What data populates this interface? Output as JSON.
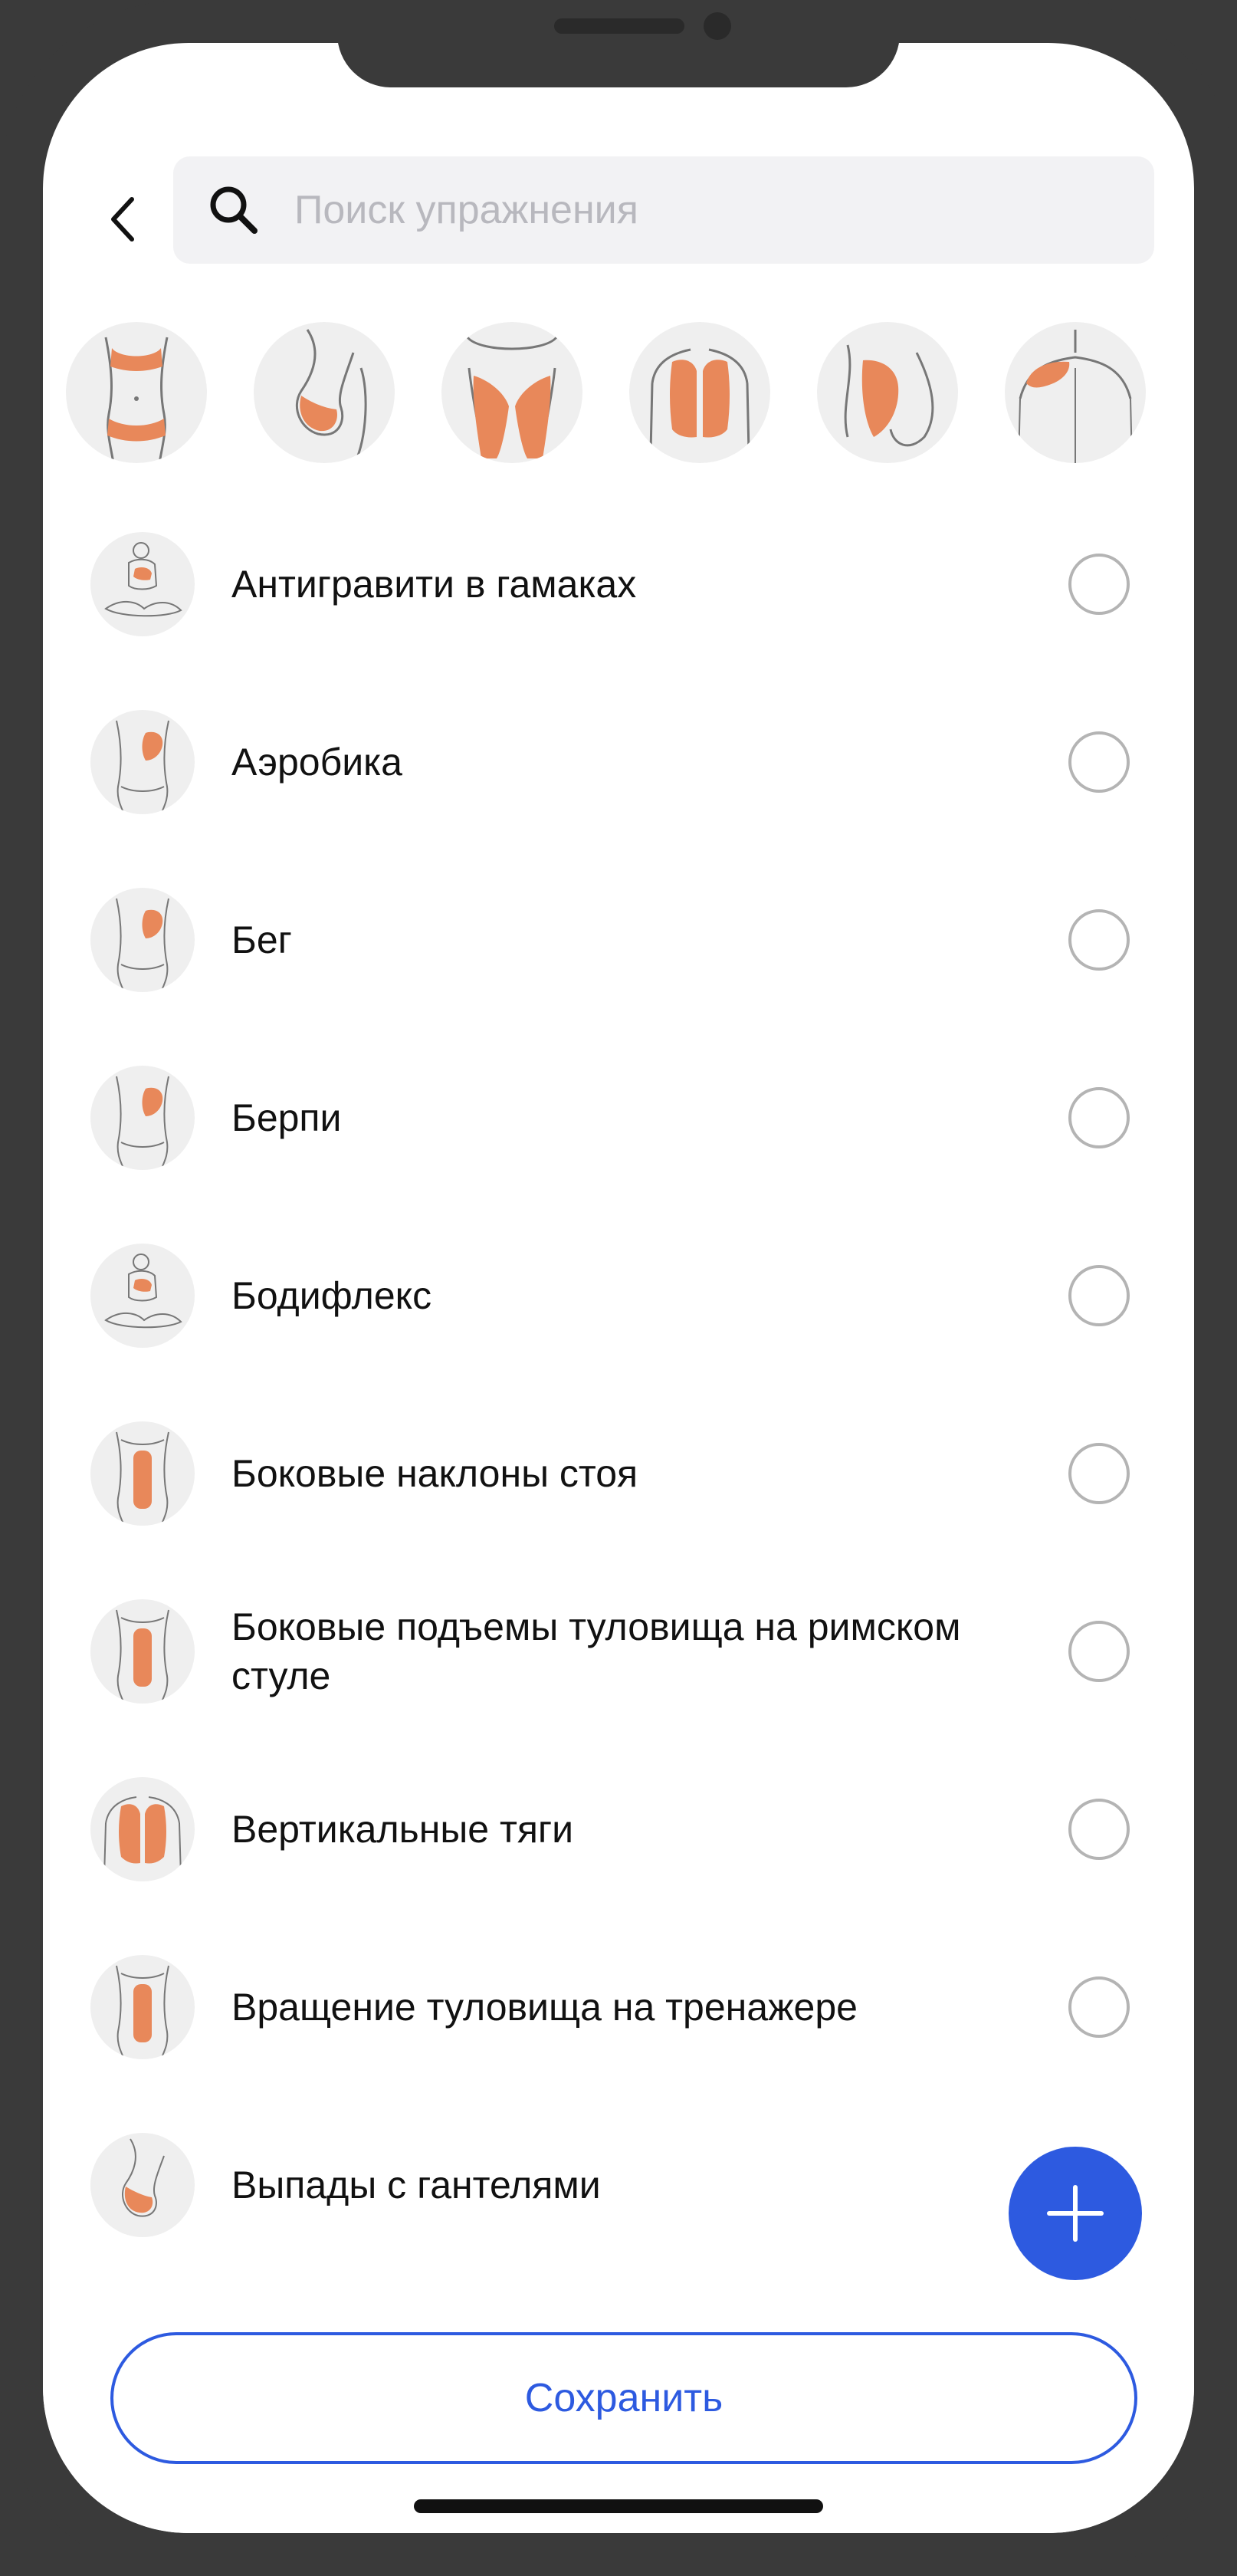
{
  "header": {
    "search_placeholder": "Поиск упражнения",
    "search_value": ""
  },
  "body_parts": [
    {
      "icon": "body-front-waist-icon"
    },
    {
      "icon": "body-side-glutes-icon"
    },
    {
      "icon": "legs-thighs-icon"
    },
    {
      "icon": "back-lats-icon"
    },
    {
      "icon": "chest-side-icon"
    },
    {
      "icon": "shoulder-back-icon"
    }
  ],
  "exercises": [
    {
      "label": "Антигравити в гамаках",
      "icon": "yoga-pose-icon",
      "selected": false
    },
    {
      "label": "Аэробика",
      "icon": "torso-chest-icon",
      "selected": false
    },
    {
      "label": "Бег",
      "icon": "torso-chest-icon",
      "selected": false
    },
    {
      "label": "Берпи",
      "icon": "torso-chest-icon",
      "selected": false
    },
    {
      "label": "Бодифлекс",
      "icon": "yoga-pose-icon",
      "selected": false
    },
    {
      "label": "Боковые наклоны стоя",
      "icon": "torso-abs-icon",
      "selected": false
    },
    {
      "label": "Боковые подъемы туловища на римском стуле",
      "icon": "torso-abs-icon",
      "selected": false
    },
    {
      "label": "Вертикальные тяги",
      "icon": "back-lats-icon",
      "selected": false
    },
    {
      "label": "Вращение туловища на тренажере",
      "icon": "torso-abs-icon",
      "selected": false
    },
    {
      "label": "Выпады с гантелями",
      "icon": "body-side-glutes-icon",
      "selected": false
    }
  ],
  "actions": {
    "save_label": "Сохранить"
  },
  "colors": {
    "accent": "#2d5ae0",
    "muscle": "#e8885a",
    "radio_border": "#b4b4b4"
  }
}
